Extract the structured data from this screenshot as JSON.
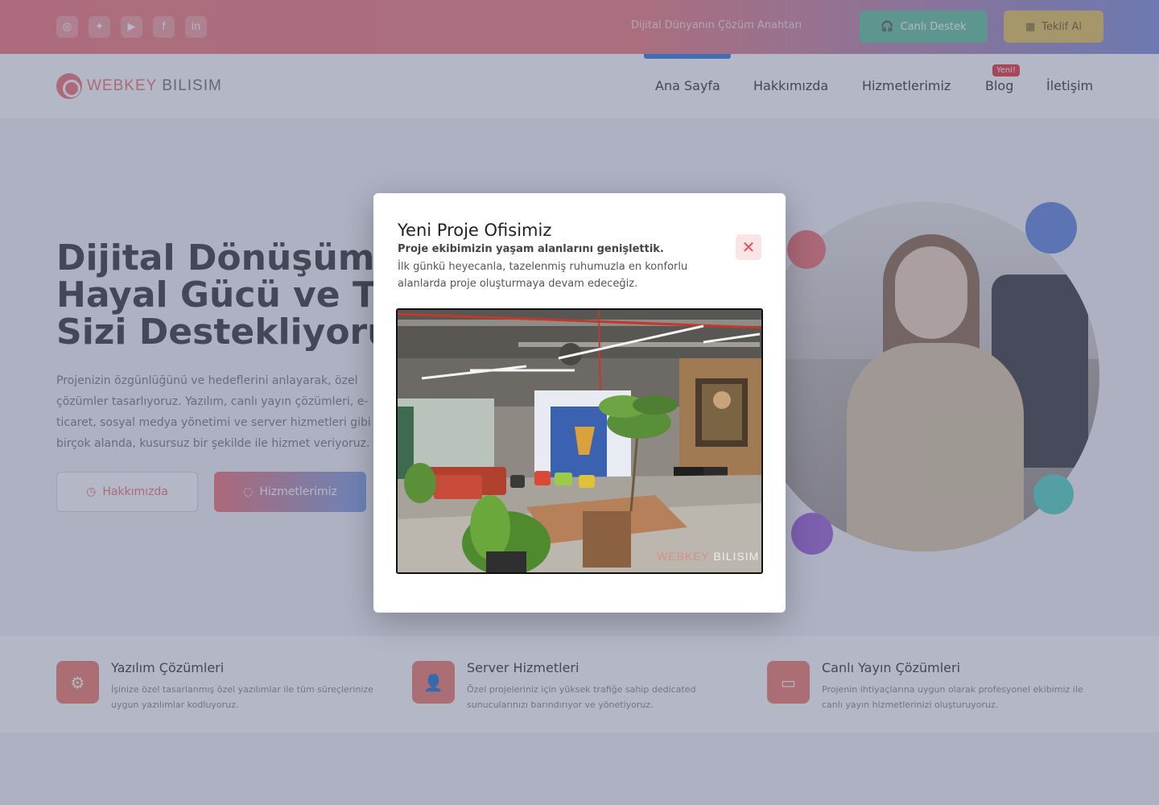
{
  "topbar": {
    "social": [
      {
        "name": "instagram",
        "glyph": "◎"
      },
      {
        "name": "twitter",
        "glyph": "✦"
      },
      {
        "name": "youtube",
        "glyph": "▶"
      },
      {
        "name": "facebook",
        "glyph": "f"
      },
      {
        "name": "linkedin",
        "glyph": "in"
      }
    ],
    "tagline": "Dijital Dünyanın Çözüm Anahtarı",
    "live_support_label": "Canlı Destek",
    "quote_label": "Teklif Al"
  },
  "brand": {
    "name_part1": "WEBKEY",
    "name_part2": " BILISIM"
  },
  "nav": {
    "items": [
      "Ana Sayfa",
      "Hakkımızda",
      "Hizmetlerimiz",
      "Blog",
      "İletişim"
    ],
    "new_badge": "Yeni!"
  },
  "hero": {
    "title_lines": [
      "Dijital Dönüşüm Çağında",
      "Hayal Gücü ve Teknoloji",
      "Sizi Destekliyoruz!"
    ],
    "description": "Projenizin özgünlüğünü ve hedeflerini anlayarak, özel çözümler tasarlıyoruz. Yazılım, canlı yayın çözümleri, e-ticaret, sosyal medya yönetimi ve server hizmetleri gibi birçok alanda, kusursuz bir şekilde ile hizmet veriyoruz.",
    "about_button": "Hakkımızda",
    "services_button": "Hizmetlerimiz"
  },
  "features": [
    {
      "title": "Yazılım Çözümleri",
      "desc": "İşinize özel tasarlanmış özel yazılımlar ile tüm süreçlerinize uygun yazılımlar kodluyoruz."
    },
    {
      "title": "Server Hizmetleri",
      "desc": "Özel projeleriniz için yüksek trafiğe sahip dedicated sunucularınızı barındırıyor ve yönetiyoruz."
    },
    {
      "title": "Canlı Yayın Çözümleri",
      "desc": "Projenin ihtiyaçlarına uygun olarak profesyonel ekibimiz ile canlı yayın hizmetlerinizi oluşturuyoruz."
    }
  ],
  "modal": {
    "title": "Yeni Proje Ofisimiz",
    "subtitle": "Proje ekibimizin yaşam alanlarını genişlettik.",
    "text": "İlk günkü heyecanla, tazelenmiş ruhumuzla en konforlu alanlarda proje oluşturmaya devam edeceğiz.",
    "close_glyph": "✕",
    "image_watermark_part1": "WEBKEY",
    "image_watermark_part2": " BILISIM"
  },
  "colors": {
    "accent": "#f07173",
    "active_nav": "#2f7de0",
    "live_support": "#5fc49a",
    "quote": "#e6c45a",
    "badge": "#e8333b"
  }
}
